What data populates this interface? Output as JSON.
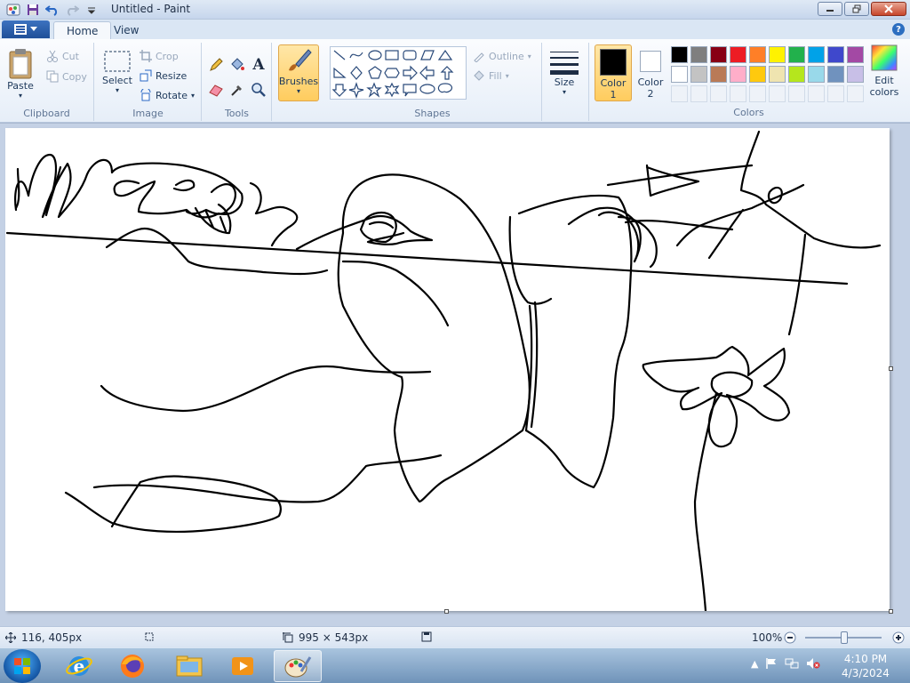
{
  "window": {
    "title": "Untitled - Paint"
  },
  "tabs": [
    {
      "label": "Home"
    },
    {
      "label": "View"
    }
  ],
  "ribbon": {
    "clipboard": {
      "label": "Clipboard",
      "paste": "Paste",
      "cut": "Cut",
      "copy": "Copy"
    },
    "image": {
      "label": "Image",
      "select": "Select",
      "crop": "Crop",
      "resize": "Resize",
      "rotate": "Rotate"
    },
    "tools": {
      "label": "Tools"
    },
    "brushes": {
      "label": "Brushes"
    },
    "shapes": {
      "label": "Shapes",
      "outline": "Outline",
      "fill": "Fill"
    },
    "size": {
      "label": "Size"
    },
    "colors": {
      "label": "Colors",
      "color1": {
        "label": "Color",
        "num": "1",
        "value": "#000000"
      },
      "color2": {
        "label": "Color",
        "num": "2",
        "value": "#ffffff"
      },
      "edit": "Edit colors",
      "edit_line1": "Edit",
      "edit_line2": "colors",
      "palette_row1": [
        "#000000",
        "#7f7f7f",
        "#880015",
        "#ed1c24",
        "#ff7f27",
        "#fff200",
        "#22b14c",
        "#00a2e8",
        "#3f48cc",
        "#a349a4"
      ],
      "palette_row2": [
        "#ffffff",
        "#c3c3c3",
        "#b97a57",
        "#ffaec9",
        "#ffc90e",
        "#efe4b0",
        "#b5e61d",
        "#99d9ea",
        "#7092be",
        "#c8bfe7"
      ]
    }
  },
  "status": {
    "cursor_pos": "116, 405px",
    "canvas_size": "995 × 543px",
    "zoom": "100%",
    "zoom_level": 1.0
  },
  "taskbar": {
    "time": "4:10 PM",
    "date": "4/3/2024"
  }
}
